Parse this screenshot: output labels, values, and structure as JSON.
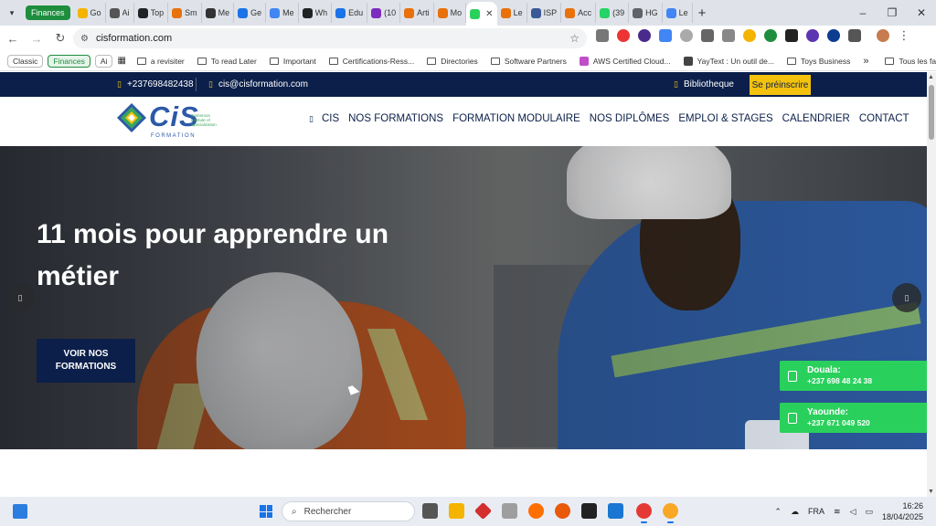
{
  "browser": {
    "tab_group": "Finances",
    "tabs": [
      {
        "label": "Go",
        "color": "#f4b400"
      },
      {
        "label": "Ai",
        "color": "#555555"
      },
      {
        "label": "Top",
        "color": "#202124"
      },
      {
        "label": "Sm",
        "color": "#e8710a"
      },
      {
        "label": "Me",
        "color": "#333333"
      },
      {
        "label": "Ge",
        "color": "#1a73e8"
      },
      {
        "label": "Me",
        "color": "#4285f4"
      },
      {
        "label": "Wh",
        "color": "#202124"
      },
      {
        "label": "Edu",
        "color": "#1a73e8"
      },
      {
        "label": "(10",
        "color": "#7b2cbf"
      },
      {
        "label": "Arti",
        "color": "#e8710a"
      },
      {
        "label": "Mo",
        "color": "#e8710a"
      },
      {
        "label": "",
        "color": "#2ad05c",
        "active": true
      },
      {
        "label": "Le",
        "color": "#e8710a"
      },
      {
        "label": "ISP",
        "color": "#3b5998"
      },
      {
        "label": "Acc",
        "color": "#e8710a"
      },
      {
        "label": "(39",
        "color": "#25d366"
      },
      {
        "label": "HG",
        "color": "#5f6368"
      },
      {
        "label": "Le",
        "color": "#4285f4"
      }
    ],
    "url": "cisformation.com",
    "bookmarks_chips": [
      "Classic",
      "Finances",
      "Ai"
    ],
    "bookmarks": [
      {
        "label": "a revisiter",
        "type": "folder"
      },
      {
        "label": "To read Later",
        "type": "folder"
      },
      {
        "label": "Important",
        "type": "folder"
      },
      {
        "label": "Certifications-Ress...",
        "type": "folder"
      },
      {
        "label": "Directories",
        "type": "folder"
      },
      {
        "label": "Software Partners",
        "type": "folder"
      },
      {
        "label": "AWS Certified Cloud...",
        "type": "fav",
        "color": "#c04ec9"
      },
      {
        "label": "YayText : Un outil de...",
        "type": "fav",
        "color": "#444444"
      },
      {
        "label": "Toys Business",
        "type": "folder"
      }
    ],
    "bookmarks_overflow": "»",
    "all_bookmarks": "Tous les favoris"
  },
  "site": {
    "topbar": {
      "phone": "+237698482438",
      "email": "cis@cisformation.com",
      "library": "Bibliotheque",
      "register": "Se préinscrire"
    },
    "logo": {
      "word": "CiS",
      "sub": "FORMATION",
      "tagline": "Cameroon Institute of Specialization"
    },
    "nav": [
      "CIS",
      "NOS FORMATIONS",
      "FORMATION MODULAIRE",
      "NOS DIPLÔMES",
      "EMPLOI & STAGES",
      "CALENDRIER",
      "CONTACT"
    ],
    "hero": {
      "title": "11 mois pour apprendre un métier",
      "cta": "VOIR NOS FORMATIONS"
    },
    "contacts": [
      {
        "city": "Douala:",
        "phone": "+237 698 48 24 38"
      },
      {
        "city": "Yaounde:",
        "phone": "+237 671 049 520"
      }
    ],
    "colors": {
      "navy": "#0b1f4a",
      "accent_yellow": "#f4c20d",
      "whatsapp_green": "#2ad05c"
    }
  },
  "taskbar": {
    "search_placeholder": "Rechercher",
    "language": "FRA",
    "time": "16:26",
    "date": "18/04/2025"
  }
}
